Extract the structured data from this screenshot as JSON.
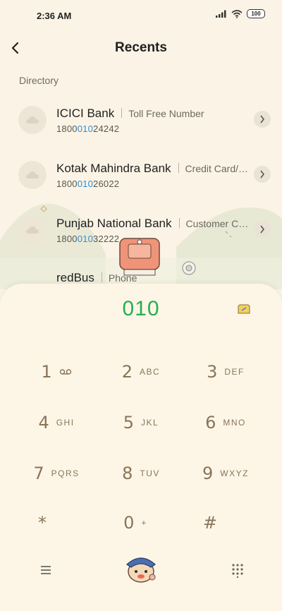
{
  "status_bar": {
    "time": "2:36 AM",
    "battery": "100"
  },
  "header": {
    "title": "Recents"
  },
  "section": {
    "label": "Directory"
  },
  "directory": [
    {
      "name": "ICICI Bank",
      "desc": "Toll Free Number",
      "num_pre": "1800",
      "num_hl": "010",
      "num_post": "24242"
    },
    {
      "name": "Kotak Mahindra Bank",
      "desc": "Credit Card/…",
      "num_pre": "1800",
      "num_hl": "010",
      "num_post": "26022"
    },
    {
      "name": "Punjab National Bank",
      "desc": "Customer C…",
      "num_pre": "1800",
      "num_hl": "010",
      "num_post": "32222"
    },
    {
      "name": "redBus",
      "desc": "Phone"
    }
  ],
  "dialer": {
    "input": "010",
    "keys": [
      {
        "digit": "1",
        "letters": "",
        "icon": "voicemail-icon"
      },
      {
        "digit": "2",
        "letters": "ABC"
      },
      {
        "digit": "3",
        "letters": "DEF"
      },
      {
        "digit": "4",
        "letters": "GHI"
      },
      {
        "digit": "5",
        "letters": "JKL"
      },
      {
        "digit": "6",
        "letters": "MNO"
      },
      {
        "digit": "7",
        "letters": "PQRS"
      },
      {
        "digit": "8",
        "letters": "TUV"
      },
      {
        "digit": "9",
        "letters": "WXYZ"
      },
      {
        "digit": "*",
        "letters": ""
      },
      {
        "digit": "0",
        "letters": "+"
      },
      {
        "digit": "#",
        "letters": ""
      }
    ]
  },
  "colors": {
    "accent_green": "#27ae4f",
    "highlight_blue": "#2a8ed8",
    "key_brown": "#8a7458",
    "background": "#fbf4e6"
  },
  "icons": [
    "back-arrow-icon",
    "signal-icon",
    "wifi-icon",
    "battery-icon",
    "cloud-avatar-icon",
    "chevron-right-icon",
    "sim-card-icon",
    "voicemail-icon",
    "menu-icon",
    "call-icon",
    "dialpad-icon"
  ]
}
